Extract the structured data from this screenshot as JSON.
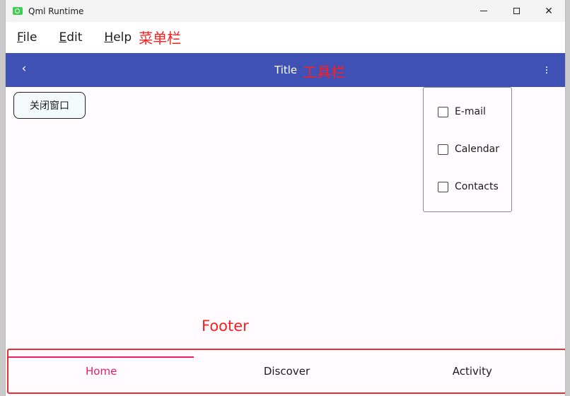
{
  "window": {
    "title": "Qml Runtime",
    "controls": {
      "minimize": "minimize-icon",
      "maximize": "maximize-icon",
      "close": "✕"
    }
  },
  "menubar": {
    "items": [
      {
        "label": "File",
        "mnemonic": "F",
        "rest": "ile"
      },
      {
        "label": "Edit",
        "mnemonic": "E",
        "rest": "dit"
      },
      {
        "label": "Help",
        "mnemonic": "H",
        "rest": "elp"
      }
    ],
    "annotation": "菜单栏"
  },
  "toolbar": {
    "back_glyph": "‹",
    "title": "Title",
    "annotation": "工具栏",
    "bg_color": "#3f51b5"
  },
  "main": {
    "close_button_label": "关闭窗口"
  },
  "popup": {
    "items": [
      {
        "label": "E-mail",
        "checked": false
      },
      {
        "label": "Calendar",
        "checked": false
      },
      {
        "label": "Contacts",
        "checked": false
      }
    ]
  },
  "footer": {
    "annotation": "Footer",
    "tabs": [
      {
        "label": "Home",
        "active": true
      },
      {
        "label": "Discover",
        "active": false
      },
      {
        "label": "Activity",
        "active": false
      }
    ],
    "accent_color": "#e91e63",
    "annotation_color": "#ff1e1e"
  }
}
